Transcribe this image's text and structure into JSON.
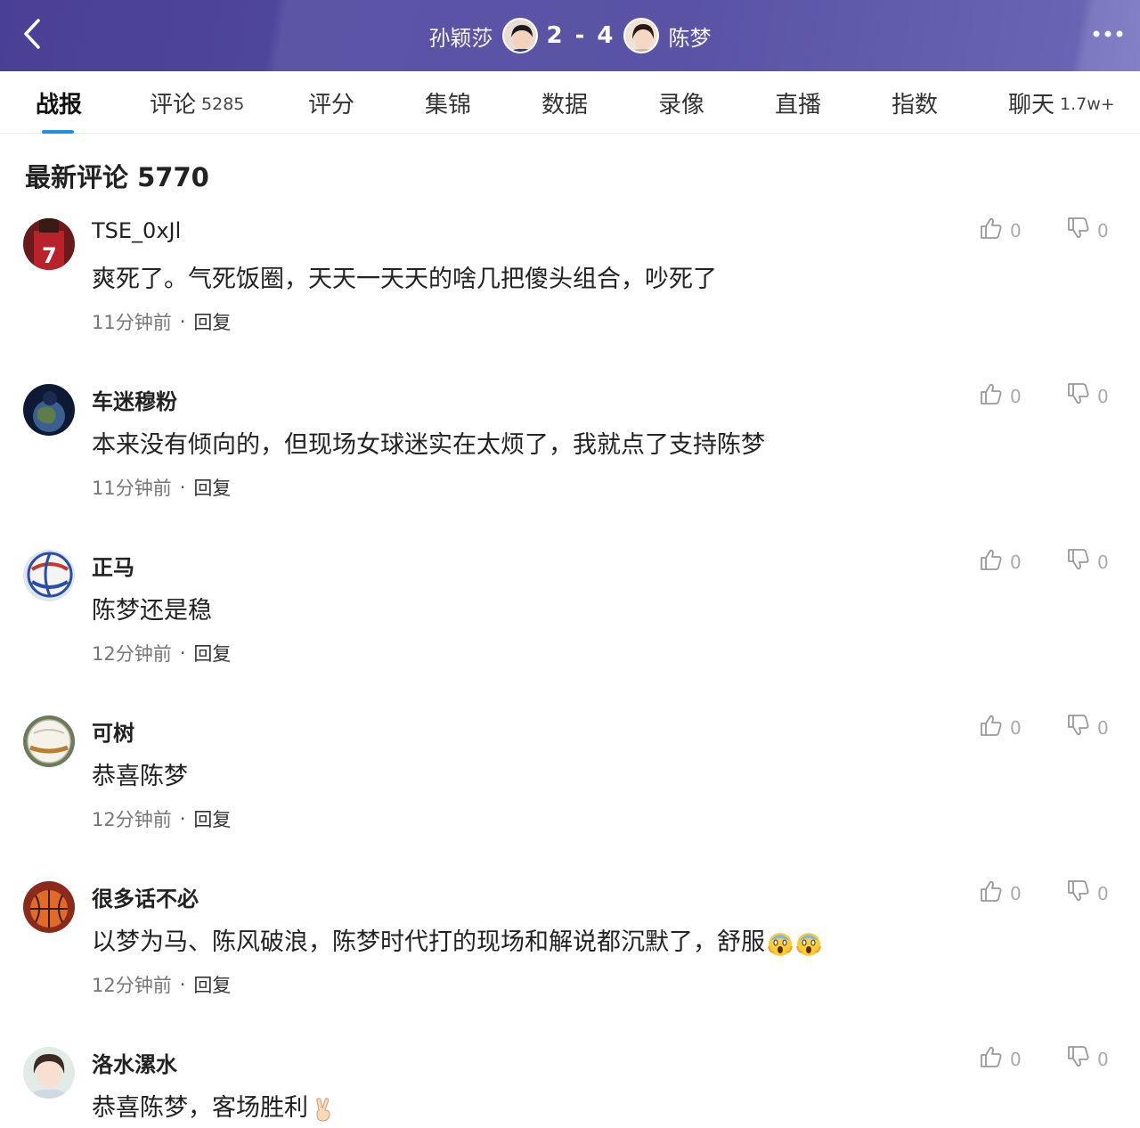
{
  "header": {
    "player_left": "孙颖莎",
    "score_left": "2",
    "score_sep": "-",
    "score_right": "4",
    "player_right": "陈梦"
  },
  "tabs": [
    {
      "label": "战报",
      "count": ""
    },
    {
      "label": "评论",
      "count": "5285"
    },
    {
      "label": "评分",
      "count": ""
    },
    {
      "label": "集锦",
      "count": ""
    },
    {
      "label": "数据",
      "count": ""
    },
    {
      "label": "录像",
      "count": ""
    },
    {
      "label": "直播",
      "count": ""
    },
    {
      "label": "指数",
      "count": ""
    },
    {
      "label": "聊天",
      "count": "1.7w+"
    }
  ],
  "section_title": "最新评论 5770",
  "reply_label": "回复",
  "dot": "·",
  "comments": [
    {
      "user": "TSE_0xJl",
      "text": "爽死了。气死饭圈，天天一天天的啥几把傻头组合，吵死了",
      "time": "11分钟前",
      "likes": "0",
      "dislikes": "0"
    },
    {
      "user": "车迷穆粉",
      "text": "本来没有倾向的，但现场女球迷实在太烦了，我就点了支持陈梦",
      "time": "11分钟前",
      "likes": "0",
      "dislikes": "0"
    },
    {
      "user": "正马",
      "text": "陈梦还是稳",
      "time": "12分钟前",
      "likes": "0",
      "dislikes": "0"
    },
    {
      "user": "可树",
      "text": "恭喜陈梦",
      "time": "12分钟前",
      "likes": "0",
      "dislikes": "0"
    },
    {
      "user": "很多话不必",
      "text": "以梦为马、陈风破浪，陈梦时代打的现场和解说都沉默了，舒服",
      "time": "12分钟前",
      "likes": "0",
      "dislikes": "0"
    },
    {
      "user": "洛水漯水",
      "text": "恭喜陈梦，客场胜利",
      "time": "",
      "likes": "0",
      "dislikes": "0"
    }
  ]
}
